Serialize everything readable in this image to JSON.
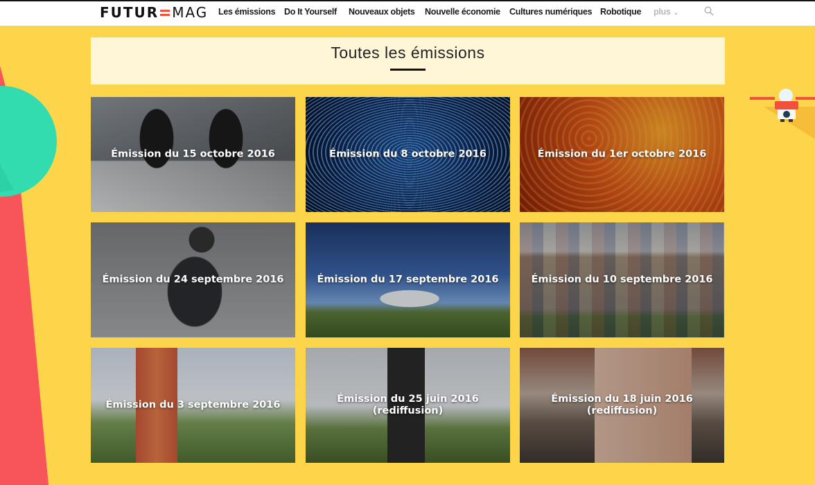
{
  "header": {
    "logo_left": "FUTUR",
    "logo_right": "MAG",
    "nav": [
      {
        "label": "Les émissions"
      },
      {
        "label": "Do It Yourself"
      },
      {
        "label": "Nouveaux objets"
      },
      {
        "label": "Nouvelle économie"
      },
      {
        "label": "Cultures numériques"
      },
      {
        "label": "Robotique"
      }
    ],
    "more_label": "plus",
    "more_icon": "chevron-down-icon",
    "search_icon": "search-icon"
  },
  "page": {
    "title": "Toutes les émissions"
  },
  "episodes": [
    {
      "line1": "Émission du 15 octobre 2016",
      "line2": ""
    },
    {
      "line1": "Émission du 8 octobre 2016",
      "line2": ""
    },
    {
      "line1": "Émission du 1er octobre 2016",
      "line2": ""
    },
    {
      "line1": "Émission du 24 septembre 2016",
      "line2": ""
    },
    {
      "line1": "Émission du 17 septembre 2016",
      "line2": ""
    },
    {
      "line1": "Émission du 10 septembre 2016",
      "line2": ""
    },
    {
      "line1": "Émission du 3 septembre 2016",
      "line2": ""
    },
    {
      "line1": "Émission du 25 juin 2016",
      "line2": "(rediffusion)"
    },
    {
      "line1": "Émission du 18 juin 2016",
      "line2": "(rediffusion)"
    }
  ],
  "colors": {
    "background": "#fdd54a",
    "accent_red": "#f0503c",
    "accent_green": "#2ed9a8",
    "title_box": "#fff6d8"
  }
}
